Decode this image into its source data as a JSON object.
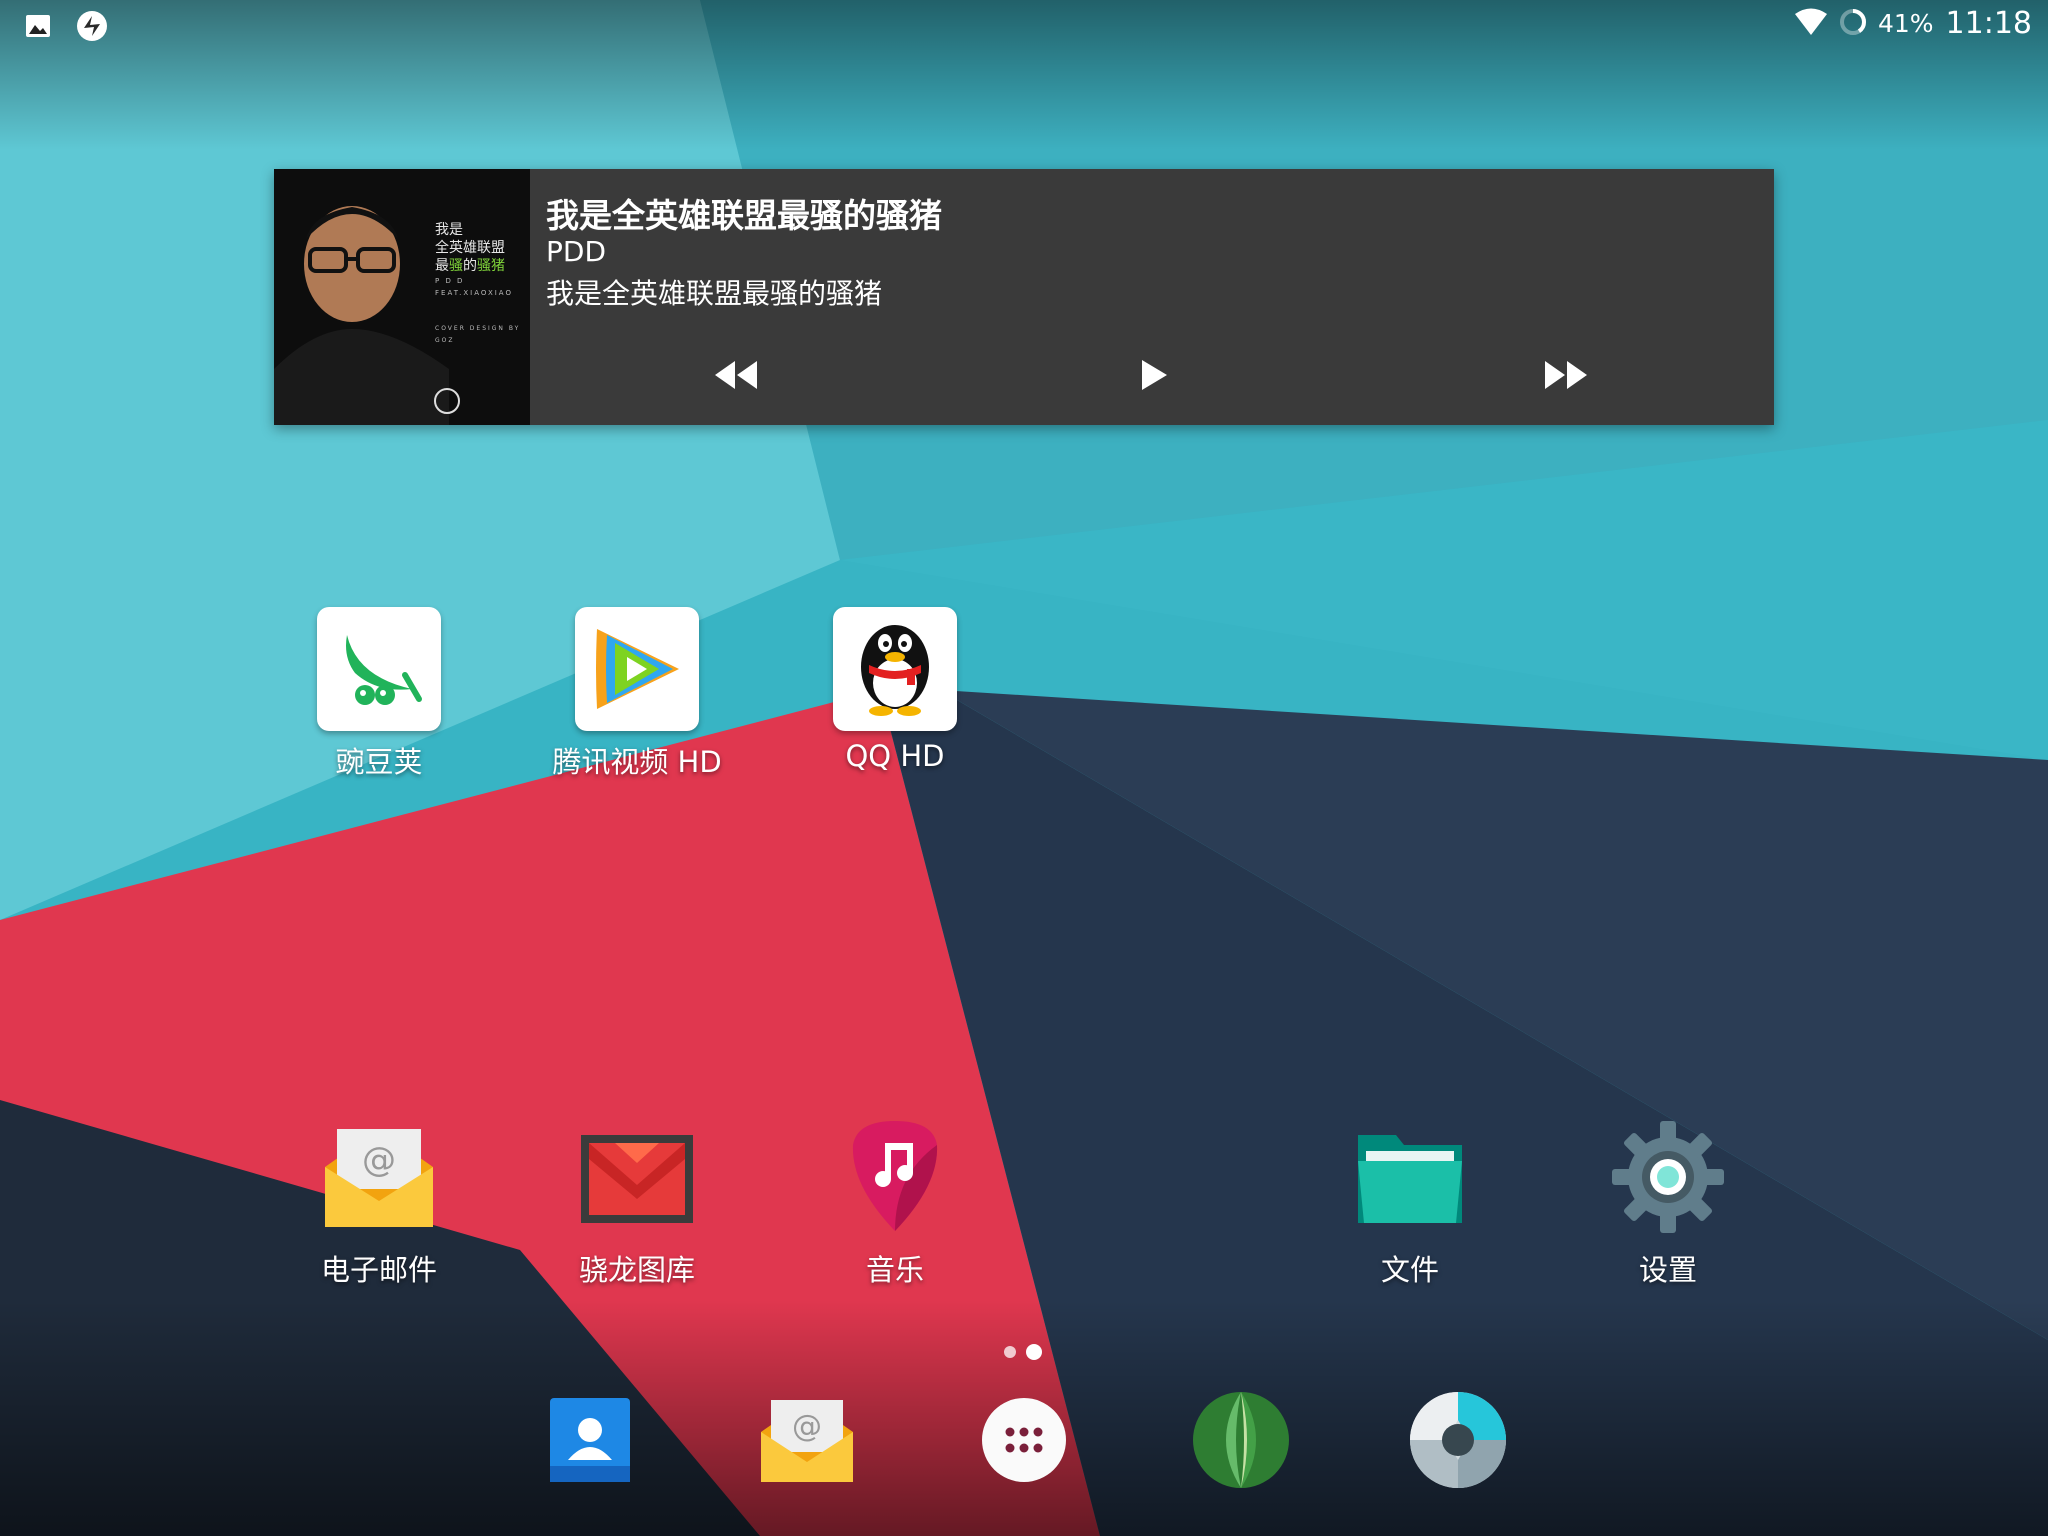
{
  "status_bar": {
    "battery_percent": "41%",
    "time": "11:18",
    "left_icons": [
      "gallery-notification-icon",
      "sync-notification-icon"
    ],
    "right_icons": [
      "wifi-icon",
      "battery-icon"
    ]
  },
  "music_widget": {
    "title": "我是全英雄联盟最骚的骚猪",
    "artist": "PDD",
    "album": "我是全英雄联盟最骚的骚猪",
    "album_art": {
      "line1": "我是",
      "line2": "全英雄联盟",
      "line3a": "最",
      "line3b": "骚",
      "line3c": "的",
      "line3d": "骚猪",
      "line4": "P D D",
      "line5": "FEAT.XIAOXIAO",
      "line6": "COVER DESIGN BY GOZ"
    },
    "controls": [
      "previous-icon",
      "play-icon",
      "next-icon"
    ]
  },
  "home_apps_row1": [
    {
      "label": "豌豆荚",
      "icon": "wandoujia-icon"
    },
    {
      "label": "腾讯视频 HD",
      "icon": "tencent-video-icon"
    },
    {
      "label": "QQ HD",
      "icon": "qq-penguin-icon"
    }
  ],
  "home_apps_row2": [
    {
      "label": "电子邮件",
      "icon": "email-icon"
    },
    {
      "label": "骁龙图库",
      "icon": "gallery-icon"
    },
    {
      "label": "音乐",
      "icon": "music-icon"
    },
    {
      "label": "文件",
      "icon": "folder-icon"
    },
    {
      "label": "设置",
      "icon": "settings-gear-icon"
    }
  ],
  "page_indicator": {
    "pages": 2,
    "current": 2
  },
  "dock": [
    "contacts-icon",
    "email-icon",
    "app-drawer-icon",
    "browser-icon",
    "camera-icon"
  ],
  "colors": {
    "teal": "#3fb8c8",
    "red": "#e23a52",
    "navy": "#25354b",
    "widget_bg": "#3a3a3a"
  }
}
